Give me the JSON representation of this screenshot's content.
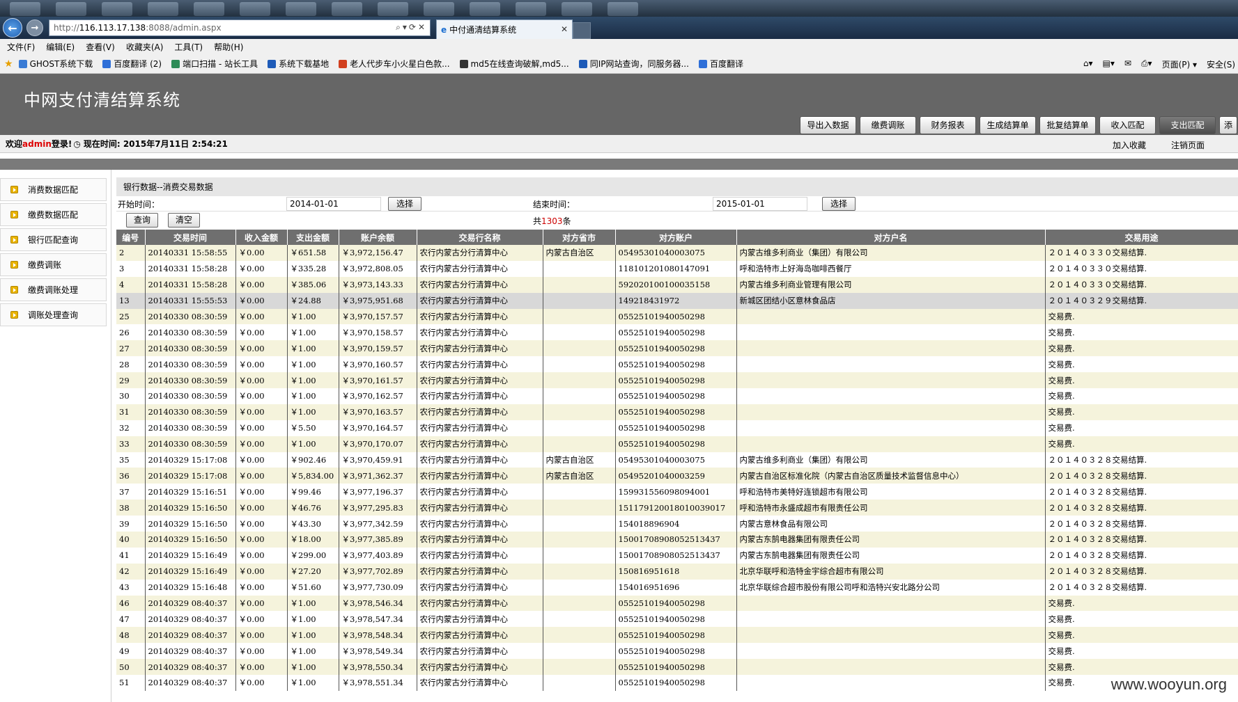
{
  "browser": {
    "url_prefix": "http://",
    "url_host": "116.113.17.138",
    "url_rest": ":8088/admin.aspx",
    "tab_title": "中付通清结算系统",
    "menu": [
      "文件(F)",
      "编辑(E)",
      "查看(V)",
      "收藏夹(A)",
      "工具(T)",
      "帮助(H)"
    ],
    "favorites": [
      {
        "label": "GHOST系统下载",
        "color": "#3a7bd5"
      },
      {
        "label": "百度翻译 (2)",
        "color": "#2f6fd8"
      },
      {
        "label": "端口扫描 - 站长工具",
        "color": "#2e8b57"
      },
      {
        "label": "系统下载基地",
        "color": "#1e5bb8"
      },
      {
        "label": "老人代步车小火星白色款...",
        "color": "#d2401f"
      },
      {
        "label": "md5在线查询破解,md5...",
        "color": "#333333"
      },
      {
        "label": "同IP网站查询，同服务器...",
        "color": "#1e5bb8"
      },
      {
        "label": "百度翻译",
        "color": "#2f6fd8"
      }
    ],
    "right_tools": [
      "页面(P) ▾",
      "安全(S)"
    ]
  },
  "app": {
    "title": "中网支付清结算系统",
    "nav": [
      "导出入数据",
      "缴费调账",
      "财务报表",
      "生成结算单",
      "批复结算单",
      "收入匹配",
      "支出匹配",
      "添"
    ],
    "active_nav": 6,
    "welcome_prefix": "欢迎",
    "user": "admin",
    "welcome_suffix": "登录!",
    "time_label": "现在时间: 2015年7月11日 2:54:21",
    "links": [
      "加入收藏",
      "注销页面"
    ]
  },
  "sidebar": {
    "items": [
      "消费数据匹配",
      "缴费数据匹配",
      "银行匹配查询",
      "缴费调账",
      "缴费调账处理",
      "调账处理查询"
    ]
  },
  "main": {
    "breadcrumb": "银行数据--消费交易数据",
    "start_label": "开始时间：",
    "start_value": "2014-01-01",
    "end_label": "结束时间：",
    "end_value": "2015-01-01",
    "pick_label": "选择",
    "query_label": "查询",
    "clear_label": "清空",
    "count_prefix": "共",
    "count": "1303",
    "count_suffix": "条"
  },
  "table": {
    "columns": [
      "编号",
      "交易时间",
      "收入金额",
      "支出金额",
      "账户余额",
      "交易行名称",
      "对方省市",
      "对方账户",
      "对方户名",
      "交易用途"
    ],
    "rows": [
      [
        "2",
        "20140331 15:58:55",
        "￥0.00",
        "￥651.58",
        "￥3,972,156.47",
        "农行内蒙古分行清算中心",
        "内蒙古自治区",
        "05495301040003075",
        "内蒙古维多利商业（集团）有限公司",
        "２０１４０３３０交易结算."
      ],
      [
        "3",
        "20140331 15:58:28",
        "￥0.00",
        "￥335.28",
        "￥3,972,808.05",
        "农行内蒙古分行清算中心",
        "",
        "118101201080147091",
        "呼和浩特市上好海岛咖啡西餐厅",
        "２０１４０３３０交易结算."
      ],
      [
        "4",
        "20140331 15:58:28",
        "￥0.00",
        "￥385.06",
        "￥3,973,143.33",
        "农行内蒙古分行清算中心",
        "",
        "592020100100035158",
        "内蒙古维多利商业管理有限公司",
        "２０１４０３３０交易结算."
      ],
      [
        "13",
        "20140331 15:55:53",
        "￥0.00",
        "￥24.88",
        "￥3,975,951.68",
        "农行内蒙古分行清算中心",
        "",
        "149218431972",
        "新城区团结小区意林食品店",
        "２０１４０３２９交易结算."
      ],
      [
        "25",
        "20140330 08:30:59",
        "￥0.00",
        "￥1.00",
        "￥3,970,157.57",
        "农行内蒙古分行清算中心",
        "",
        "05525101940050298",
        "",
        "交易费."
      ],
      [
        "26",
        "20140330 08:30:59",
        "￥0.00",
        "￥1.00",
        "￥3,970,158.57",
        "农行内蒙古分行清算中心",
        "",
        "05525101940050298",
        "",
        "交易费."
      ],
      [
        "27",
        "20140330 08:30:59",
        "￥0.00",
        "￥1.00",
        "￥3,970,159.57",
        "农行内蒙古分行清算中心",
        "",
        "05525101940050298",
        "",
        "交易费."
      ],
      [
        "28",
        "20140330 08:30:59",
        "￥0.00",
        "￥1.00",
        "￥3,970,160.57",
        "农行内蒙古分行清算中心",
        "",
        "05525101940050298",
        "",
        "交易费."
      ],
      [
        "29",
        "20140330 08:30:59",
        "￥0.00",
        "￥1.00",
        "￥3,970,161.57",
        "农行内蒙古分行清算中心",
        "",
        "05525101940050298",
        "",
        "交易费."
      ],
      [
        "30",
        "20140330 08:30:59",
        "￥0.00",
        "￥1.00",
        "￥3,970,162.57",
        "农行内蒙古分行清算中心",
        "",
        "05525101940050298",
        "",
        "交易费."
      ],
      [
        "31",
        "20140330 08:30:59",
        "￥0.00",
        "￥1.00",
        "￥3,970,163.57",
        "农行内蒙古分行清算中心",
        "",
        "05525101940050298",
        "",
        "交易费."
      ],
      [
        "32",
        "20140330 08:30:59",
        "￥0.00",
        "￥5.50",
        "￥3,970,164.57",
        "农行内蒙古分行清算中心",
        "",
        "05525101940050298",
        "",
        "交易费."
      ],
      [
        "33",
        "20140330 08:30:59",
        "￥0.00",
        "￥1.00",
        "￥3,970,170.07",
        "农行内蒙古分行清算中心",
        "",
        "05525101940050298",
        "",
        "交易费."
      ],
      [
        "35",
        "20140329 15:17:08",
        "￥0.00",
        "￥902.46",
        "￥3,970,459.91",
        "农行内蒙古分行清算中心",
        "内蒙古自治区",
        "05495301040003075",
        "内蒙古维多利商业（集团）有限公司",
        "２０１４０３２８交易结算."
      ],
      [
        "36",
        "20140329 15:17:08",
        "￥0.00",
        "￥5,834.00",
        "￥3,971,362.37",
        "农行内蒙古分行清算中心",
        "内蒙古自治区",
        "05495201040003259",
        "内蒙古自治区标准化院（内蒙古自治区质量技术监督信息中心）",
        "２０１４０３２８交易结算."
      ],
      [
        "37",
        "20140329 15:16:51",
        "￥0.00",
        "￥99.46",
        "￥3,977,196.37",
        "农行内蒙古分行清算中心",
        "",
        "159931556098094001",
        "呼和浩特市美特好连锁超市有限公司",
        "２０１４０３２８交易结算."
      ],
      [
        "38",
        "20140329 15:16:50",
        "￥0.00",
        "￥46.76",
        "￥3,977,295.83",
        "农行内蒙古分行清算中心",
        "",
        "151179120018010039017",
        "呼和浩特市永盛成超市有限责任公司",
        "２０１４０３２８交易结算."
      ],
      [
        "39",
        "20140329 15:16:50",
        "￥0.00",
        "￥43.30",
        "￥3,977,342.59",
        "农行内蒙古分行清算中心",
        "",
        "154018896904",
        "内蒙古意林食品有限公司",
        "２０１４０３２８交易结算."
      ],
      [
        "40",
        "20140329 15:16:50",
        "￥0.00",
        "￥18.00",
        "￥3,977,385.89",
        "农行内蒙古分行清算中心",
        "",
        "1500170890805251343​7",
        "内蒙古东鹄电器集团有限责任公司",
        "２０１４０３２８交易结算."
      ],
      [
        "41",
        "20140329 15:16:49",
        "￥0.00",
        "￥299.00",
        "￥3,977,403.89",
        "农行内蒙古分行清算中心",
        "",
        "15001708908052513437",
        "内蒙古东鹄电器集团有限责任公司",
        "２０１４０３２８交易结算."
      ],
      [
        "42",
        "20140329 15:16:49",
        "￥0.00",
        "￥27.20",
        "￥3,977,702.89",
        "农行内蒙古分行清算中心",
        "",
        "150816951618",
        "北京华联呼和浩特金宇综合超市有限公司",
        "２０１４０３２８交易结算."
      ],
      [
        "43",
        "20140329 15:16:48",
        "￥0.00",
        "￥51.60",
        "￥3,977,730.09",
        "农行内蒙古分行清算中心",
        "",
        "154016951696",
        "北京华联综合超市股份有限公司呼和浩特兴安北路分公司",
        "２０１４０３２８交易结算."
      ],
      [
        "46",
        "20140329 08:40:37",
        "￥0.00",
        "￥1.00",
        "￥3,978,546.34",
        "农行内蒙古分行清算中心",
        "",
        "05525101940050298",
        "",
        "交易费."
      ],
      [
        "47",
        "20140329 08:40:37",
        "￥0.00",
        "￥1.00",
        "￥3,978,547.34",
        "农行内蒙古分行清算中心",
        "",
        "05525101940050298",
        "",
        "交易费."
      ],
      [
        "48",
        "20140329 08:40:37",
        "￥0.00",
        "￥1.00",
        "￥3,978,548.34",
        "农行内蒙古分行清算中心",
        "",
        "05525101940050298",
        "",
        "交易费."
      ],
      [
        "49",
        "20140329 08:40:37",
        "￥0.00",
        "￥1.00",
        "￥3,978,549.34",
        "农行内蒙古分行清算中心",
        "",
        "05525101940050298",
        "",
        "交易费."
      ],
      [
        "50",
        "20140329 08:40:37",
        "￥0.00",
        "￥1.00",
        "￥3,978,550.34",
        "农行内蒙古分行清算中心",
        "",
        "05525101940050298",
        "",
        "交易费."
      ],
      [
        "51",
        "20140329 08:40:37",
        "￥0.00",
        "￥1.00",
        "￥3,978,551.34",
        "农行内蒙古分行清算中心",
        "",
        "05525101940050298",
        "",
        "交易费."
      ]
    ],
    "highlight_row": 3
  },
  "watermark": "www.wooyun.org"
}
